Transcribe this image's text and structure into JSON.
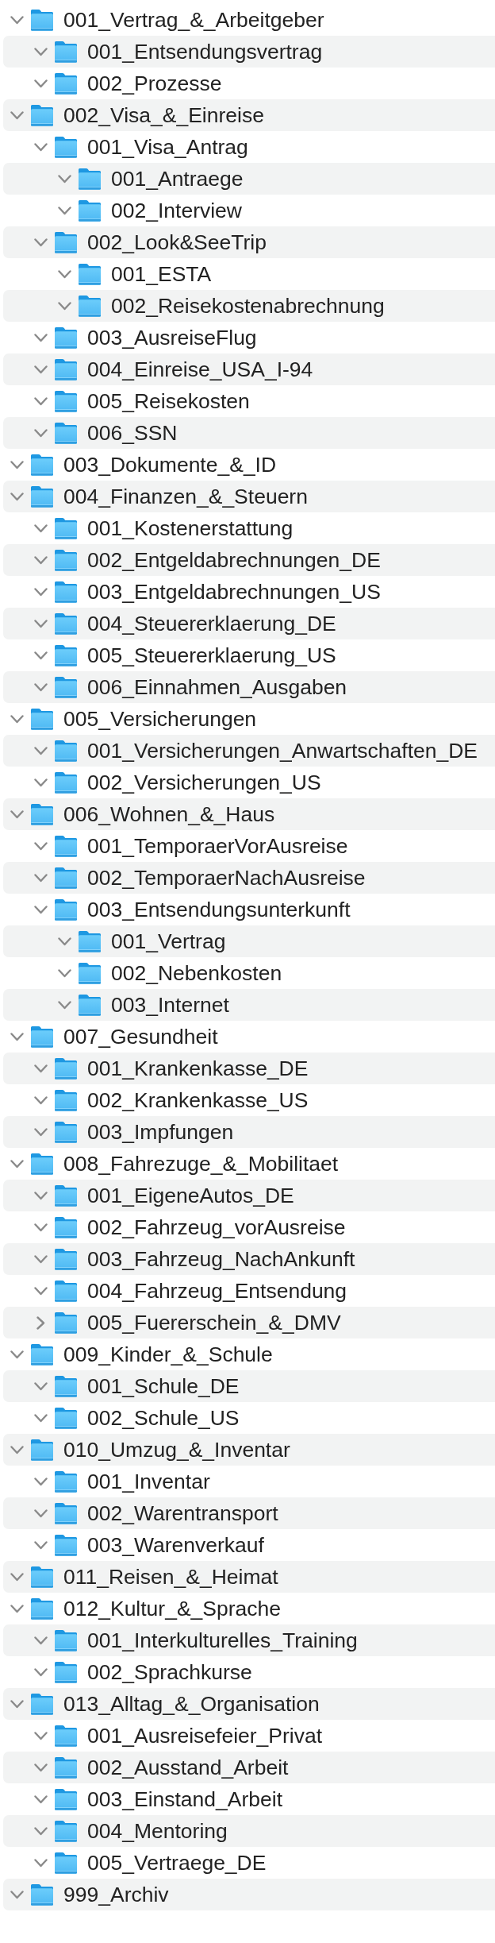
{
  "folders": [
    {
      "name": "001_Vertrag_&_Arbeitgeber",
      "expanded": true,
      "children": [
        {
          "name": "001_Entsendungsvertrag",
          "expanded": true
        },
        {
          "name": "002_Prozesse",
          "expanded": true
        }
      ]
    },
    {
      "name": "002_Visa_&_Einreise",
      "expanded": true,
      "children": [
        {
          "name": "001_Visa_Antrag",
          "expanded": true,
          "children": [
            {
              "name": "001_Antraege",
              "expanded": true
            },
            {
              "name": "002_Interview",
              "expanded": true
            }
          ]
        },
        {
          "name": "002_Look&SeeTrip",
          "expanded": true,
          "children": [
            {
              "name": "001_ESTA",
              "expanded": true
            },
            {
              "name": "002_Reisekostenabrechnung",
              "expanded": true
            }
          ]
        },
        {
          "name": "003_AusreiseFlug",
          "expanded": true
        },
        {
          "name": "004_Einreise_USA_I-94",
          "expanded": true
        },
        {
          "name": "005_Reisekosten",
          "expanded": true
        },
        {
          "name": "006_SSN",
          "expanded": true
        }
      ]
    },
    {
      "name": "003_Dokumente_&_ID",
      "expanded": true
    },
    {
      "name": "004_Finanzen_&_Steuern",
      "expanded": true,
      "children": [
        {
          "name": "001_Kostenerstattung",
          "expanded": true
        },
        {
          "name": "002_Entgeldabrechnungen_DE",
          "expanded": true
        },
        {
          "name": "003_Entgeldabrechnungen_US",
          "expanded": true
        },
        {
          "name": "004_Steuererklaerung_DE",
          "expanded": true
        },
        {
          "name": "005_Steuererklaerung_US",
          "expanded": true
        },
        {
          "name": "006_Einnahmen_Ausgaben",
          "expanded": true
        }
      ]
    },
    {
      "name": "005_Versicherungen",
      "expanded": true,
      "children": [
        {
          "name": "001_Versicherungen_Anwartschaften_DE",
          "expanded": true
        },
        {
          "name": "002_Versicherungen_US",
          "expanded": true
        }
      ]
    },
    {
      "name": "006_Wohnen_&_Haus",
      "expanded": true,
      "children": [
        {
          "name": "001_TemporaerVorAusreise",
          "expanded": true
        },
        {
          "name": "002_TemporaerNachAusreise",
          "expanded": true
        },
        {
          "name": "003_Entsendungsunterkunft",
          "expanded": true,
          "children": [
            {
              "name": "001_Vertrag",
              "expanded": true
            },
            {
              "name": "002_Nebenkosten",
              "expanded": true
            },
            {
              "name": "003_Internet",
              "expanded": true
            }
          ]
        }
      ]
    },
    {
      "name": "007_Gesundheit",
      "expanded": true,
      "children": [
        {
          "name": "001_Krankenkasse_DE",
          "expanded": true
        },
        {
          "name": "002_Krankenkasse_US",
          "expanded": true
        },
        {
          "name": "003_Impfungen",
          "expanded": true
        }
      ]
    },
    {
      "name": "008_Fahrezuge_&_Mobilitaet",
      "expanded": true,
      "children": [
        {
          "name": "001_EigeneAutos_DE",
          "expanded": true
        },
        {
          "name": "002_Fahrzeug_vorAusreise",
          "expanded": true
        },
        {
          "name": "003_Fahrzeug_NachAnkunft",
          "expanded": true
        },
        {
          "name": "004_Fahrzeug_Entsendung",
          "expanded": true
        },
        {
          "name": "005_Fuererschein_&_DMV",
          "expanded": false
        }
      ]
    },
    {
      "name": "009_Kinder_&_Schule",
      "expanded": true,
      "children": [
        {
          "name": "001_Schule_DE",
          "expanded": true
        },
        {
          "name": "002_Schule_US",
          "expanded": true
        }
      ]
    },
    {
      "name": "010_Umzug_&_Inventar",
      "expanded": true,
      "children": [
        {
          "name": "001_Inventar",
          "expanded": true
        },
        {
          "name": "002_Warentransport",
          "expanded": true
        },
        {
          "name": "003_Warenverkauf",
          "expanded": true
        }
      ]
    },
    {
      "name": "011_Reisen_&_Heimat",
      "expanded": true
    },
    {
      "name": "012_Kultur_&_Sprache",
      "expanded": true,
      "children": [
        {
          "name": "001_Interkulturelles_Training",
          "expanded": true
        },
        {
          "name": "002_Sprachkurse",
          "expanded": true
        }
      ]
    },
    {
      "name": "013_Alltag_&_Organisation",
      "expanded": true,
      "children": [
        {
          "name": "001_Ausreisefeier_Privat",
          "expanded": true
        },
        {
          "name": "002_Ausstand_Arbeit",
          "expanded": true
        },
        {
          "name": "003_Einstand_Arbeit",
          "expanded": true
        },
        {
          "name": "004_Mentoring",
          "expanded": true
        },
        {
          "name": "005_Vertraege_DE",
          "expanded": true
        }
      ]
    },
    {
      "name": "999_Archiv",
      "expanded": true
    }
  ]
}
